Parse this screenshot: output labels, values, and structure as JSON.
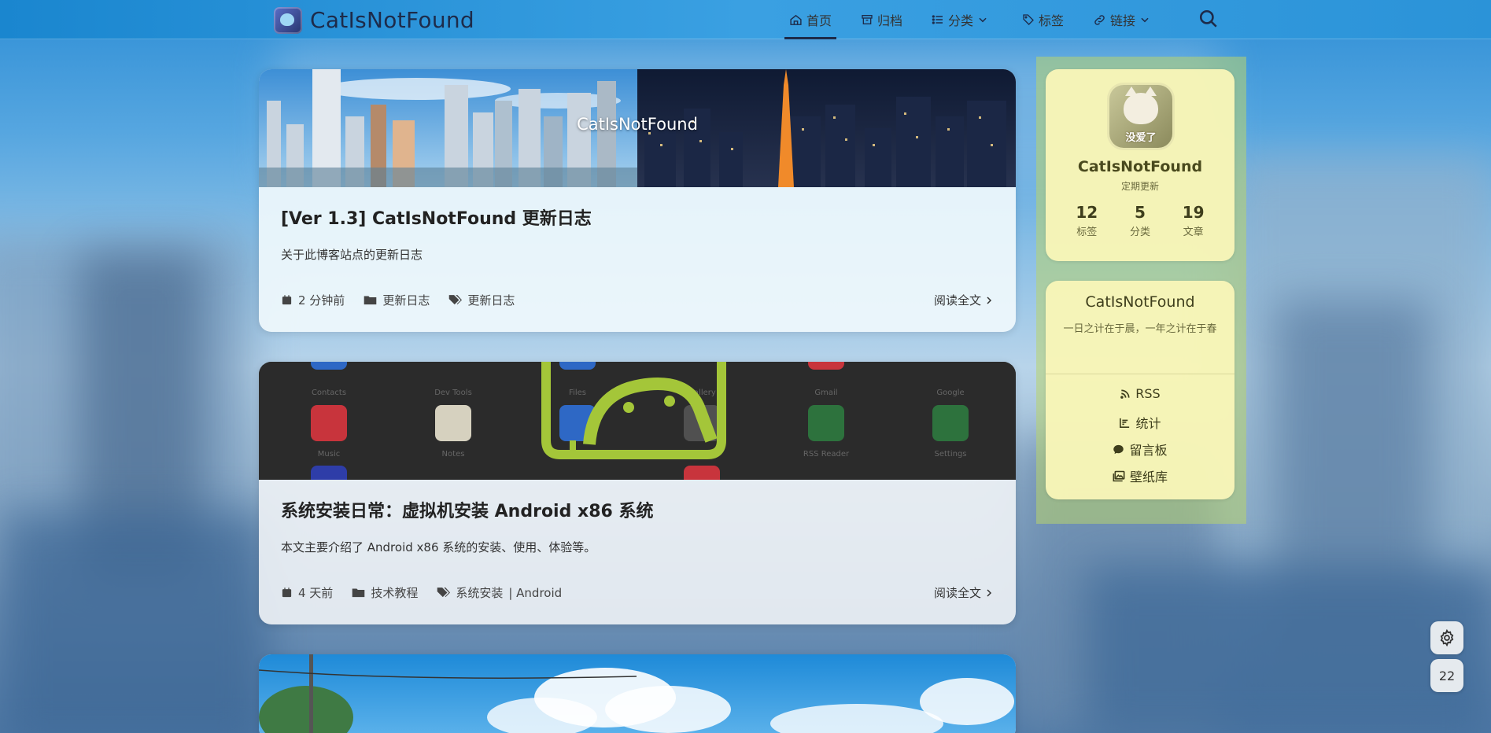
{
  "site": {
    "title": "CatIsNotFound"
  },
  "nav": {
    "items": [
      {
        "label": "首页",
        "icon": "home-icon"
      },
      {
        "label": "归档",
        "icon": "archive-icon"
      },
      {
        "label": "分类",
        "icon": "list-icon",
        "dropdown": true
      },
      {
        "label": "标签",
        "icon": "tag-icon"
      },
      {
        "label": "链接",
        "icon": "link-icon",
        "dropdown": true
      }
    ],
    "search_icon": "search-icon"
  },
  "posts": [
    {
      "banner_text": "CatIsNotFound",
      "title": "[Ver 1.3] CatIsNotFound 更新日志",
      "desc": "关于此博客站点的更新日志",
      "date": "2 分钟前",
      "category": "更新日志",
      "tags": "更新日志",
      "read_more": "阅读全文"
    },
    {
      "title": "系统安装日常：虚拟机安装 Android x86 系统",
      "desc": "本文主要介绍了 Android x86 系统的安装、使用、体验等。",
      "date": "4 天前",
      "category": "技术教程",
      "tags": "系统安装",
      "tags2": "| Android",
      "read_more": "阅读全文",
      "banner_labels": [
        "Contacts",
        "Dev Tools",
        "Files",
        "Gallery",
        "Gmail",
        "Google",
        "Music",
        "Notes",
        "RSS Reader",
        "Settings"
      ]
    }
  ],
  "profile": {
    "avatar_text": "没爱了",
    "name": "CatIsNotFound",
    "subtitle": "定期更新",
    "stats": [
      {
        "num": "12",
        "label": "标签"
      },
      {
        "num": "5",
        "label": "分类"
      },
      {
        "num": "19",
        "label": "文章"
      }
    ]
  },
  "about": {
    "title": "CatIsNotFound",
    "motto": "一日之计在于晨，一年之计在于春",
    "links": [
      {
        "label": "RSS",
        "icon": "rss-icon"
      },
      {
        "label": "统计",
        "icon": "chart-icon"
      },
      {
        "label": "留言板",
        "icon": "comment-icon"
      },
      {
        "label": "壁纸库",
        "icon": "image-icon"
      }
    ]
  },
  "fab": {
    "settings_icon": "gear-icon",
    "counter": "22"
  },
  "colors": {
    "accent": "#1d2b4a",
    "sidebar": "#f9f6b8"
  }
}
